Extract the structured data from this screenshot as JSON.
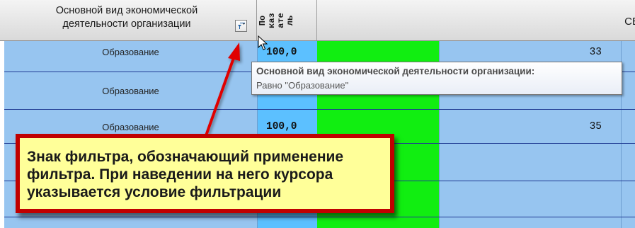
{
  "header": {
    "col_a_title": "Основной вид экономической деятельности организации",
    "col_b_vertical": [
      "По",
      "каз",
      "ате",
      "ль"
    ],
    "col_c_title": "СВЕ"
  },
  "rows": [
    {
      "activity": "Образование",
      "indicator": "100,0",
      "value": "33"
    },
    {
      "activity": "Образование",
      "indicator": "",
      "value": ""
    },
    {
      "activity": "Образование",
      "indicator": "100,0",
      "value": "35"
    }
  ],
  "tooltip": {
    "title": "Основной вид экономической деятельности организации:",
    "condition": "Равно \"Образование\""
  },
  "callout": {
    "text": "Знак фильтра, обозначающий применение фильтра. При наведении на него курсора указывается условие фильтрации"
  },
  "colors": {
    "header_bg": "#e0e0e0",
    "column_blue": "#97c5f0",
    "column_cyan": "#5cc0ff",
    "column_green": "#11ee11",
    "callout_bg": "#ffff99",
    "callout_border": "#c00000",
    "arrow": "#e00000"
  },
  "icons": [
    "filter-icon",
    "mouse-cursor-icon"
  ]
}
